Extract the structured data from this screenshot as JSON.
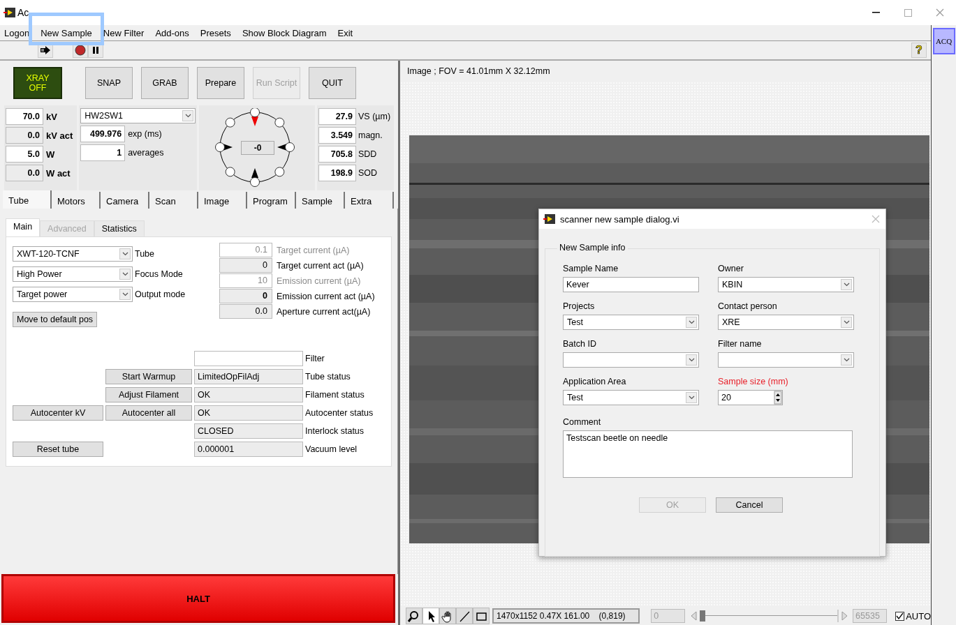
{
  "window": {
    "title": "Ac"
  },
  "menu": [
    {
      "label": "Logon",
      "highlighted": false
    },
    {
      "label": "New Sample",
      "highlighted": true
    },
    {
      "label": "New Filter",
      "highlighted": false
    },
    {
      "label": "Add-ons",
      "highlighted": false
    },
    {
      "label": "Presets",
      "highlighted": false
    },
    {
      "label": "Show Block Diagram",
      "highlighted": false
    },
    {
      "label": "Exit",
      "highlighted": false
    }
  ],
  "acq_button": "ACQ",
  "help_button": "?",
  "action_buttons": [
    {
      "label": "XRAY OFF",
      "kind": "xray",
      "disabled": false
    },
    {
      "label": "SNAP",
      "kind": "plain",
      "disabled": false
    },
    {
      "label": "GRAB",
      "kind": "plain",
      "disabled": false
    },
    {
      "label": "Prepare",
      "kind": "plain",
      "disabled": false
    },
    {
      "label": "Run Script",
      "kind": "plain",
      "disabled": true
    },
    {
      "label": "QUIT",
      "kind": "plain",
      "disabled": false
    }
  ],
  "tube_readings": [
    {
      "value": "70.0",
      "unit": "kV",
      "readonly": false
    },
    {
      "value": "0.0",
      "unit": "kV act",
      "readonly": true
    },
    {
      "value": "5.0",
      "unit": "W",
      "readonly": false
    },
    {
      "value": "0.0",
      "unit": "W act",
      "readonly": true
    }
  ],
  "camera": {
    "device": "HW2SW1",
    "fields": [
      {
        "value": "499.976",
        "unit": "exp (ms)"
      },
      {
        "value": "1",
        "unit": "averages"
      }
    ]
  },
  "rotation": {
    "value": "-0"
  },
  "geometry": [
    {
      "value": "27.9",
      "unit": "VS (µm)"
    },
    {
      "value": "3.549",
      "unit": "magn."
    },
    {
      "value": "705.8",
      "unit": "SDD"
    },
    {
      "value": "198.9",
      "unit": "SOD"
    }
  ],
  "tabs": [
    {
      "label": "Tube",
      "selected": true
    },
    {
      "label": "Motors",
      "selected": false
    },
    {
      "label": "Camera",
      "selected": false
    },
    {
      "label": "Scan",
      "selected": false
    },
    {
      "label": "Image",
      "selected": false
    },
    {
      "label": "Program",
      "selected": false
    },
    {
      "label": "Sample",
      "selected": false
    },
    {
      "label": "Extra",
      "selected": false
    }
  ],
  "subtabs": [
    {
      "label": "Main",
      "selected": true,
      "disabled": false
    },
    {
      "label": "Advanced",
      "selected": false,
      "disabled": true
    },
    {
      "label": "Statistics",
      "selected": false,
      "disabled": false
    }
  ],
  "tube_settings": [
    {
      "value": "XWT-120-TCNF",
      "label": "Tube"
    },
    {
      "value": "High Power",
      "label": "Focus Mode"
    },
    {
      "value": "Target power",
      "label": "Output mode"
    }
  ],
  "default_pos_button": "Move to default pos",
  "currents": [
    {
      "value": "0.1",
      "label": "Target current (µA)",
      "disabled": true,
      "bold": false
    },
    {
      "value": "0",
      "label": "Target current act (µA)",
      "disabled": false,
      "bold": false
    },
    {
      "value": "10",
      "label": "Emission current (µA)",
      "disabled": true,
      "bold": false
    },
    {
      "value": "0",
      "label": "Emission current act (µA)",
      "disabled": false,
      "bold": true
    },
    {
      "value": "0.0",
      "label": "Aperture current act(µA)",
      "disabled": false,
      "bold": false
    }
  ],
  "status_rows": [
    {
      "kind": "input",
      "label": "Filter"
    },
    {
      "kind": "status",
      "mid_button": "Start Warmup",
      "value": "LimitedOpFilAdj",
      "label": "Tube status"
    },
    {
      "kind": "status",
      "mid_button": "Adjust Filament",
      "value": "OK",
      "label": "Filament status"
    },
    {
      "kind": "status",
      "left_button": "Autocenter kV",
      "mid_button": "Autocenter all",
      "value": "OK",
      "label": "Autocenter status"
    },
    {
      "kind": "status",
      "value": "CLOSED",
      "label": "Interlock status"
    },
    {
      "kind": "status",
      "left_button": "Reset tube",
      "value": "0.000001",
      "label": "Vacuum level"
    }
  ],
  "halt_button": "HALT",
  "image": {
    "title": "Image ; FOV = 41.01mm X 32.12mm"
  },
  "dialog": {
    "title": "scanner new sample dialog.vi",
    "group": "New Sample info",
    "fields": [
      {
        "label": "Sample Name",
        "kind": "text",
        "value": "Kever",
        "invalid": false
      },
      {
        "label": "Owner",
        "kind": "dropdown",
        "value": "KBIN",
        "invalid": false
      },
      {
        "label": "Projects",
        "kind": "dropdown",
        "value": "Test",
        "invalid": false
      },
      {
        "label": "Contact person",
        "kind": "dropdown",
        "value": "XRE",
        "invalid": false
      },
      {
        "label": "Batch ID",
        "kind": "dropdown",
        "invalid": false
      },
      {
        "label": "Filter name",
        "kind": "dropdown",
        "invalid": false
      },
      {
        "label": "Application Area",
        "kind": "dropdown",
        "value": "Test",
        "invalid": false
      },
      {
        "label": "Sample size (mm)",
        "kind": "number",
        "value": "20",
        "invalid": true
      }
    ],
    "comment": {
      "label": "Comment",
      "value": "Testscan beetle on needle"
    },
    "buttons": [
      {
        "label": "OK",
        "disabled": true
      },
      {
        "label": "Cancel",
        "disabled": false
      }
    ]
  },
  "image_toolbar": {
    "tools": [
      {
        "kind": "zoom",
        "selected": false
      },
      {
        "kind": "pointer",
        "selected": true
      },
      {
        "kind": "pan",
        "selected": false
      },
      {
        "kind": "line",
        "selected": false
      },
      {
        "kind": "rect",
        "selected": false
      }
    ],
    "info": "1470x1152 0.47X 161.00    (0,819)",
    "range_min": "0",
    "range_max": "65535",
    "level": 0,
    "auto": {
      "label": "AUTO",
      "checked": true
    }
  }
}
